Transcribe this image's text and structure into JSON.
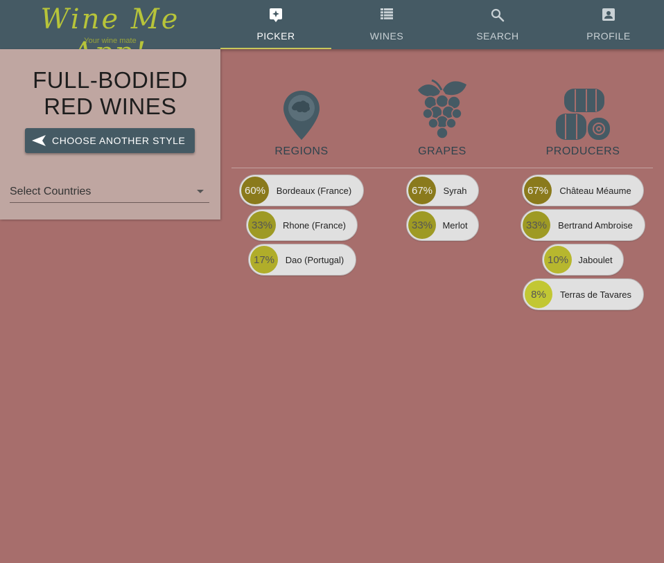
{
  "app": {
    "title": "Wine Me App!",
    "tagline": "Your wine mate"
  },
  "nav": {
    "tabs": [
      {
        "label": "PICKER",
        "icon": "sparkle-icon",
        "active": true
      },
      {
        "label": "WINES",
        "icon": "list-icon",
        "active": false
      },
      {
        "label": "SEARCH",
        "icon": "search-icon",
        "active": false
      },
      {
        "label": "PROFILE",
        "icon": "profile-icon",
        "active": false
      }
    ]
  },
  "side": {
    "title_line1": "FULL-BODIED",
    "title_line2": "RED WINES",
    "choose_label": "CHOOSE ANOTHER STYLE",
    "select_label": "Select Countries"
  },
  "columns": {
    "regions": {
      "header": "REGIONS",
      "items": [
        {
          "pct": "60%",
          "name": "Bordeaux (France)"
        },
        {
          "pct": "33%",
          "name": "Rhone (France)"
        },
        {
          "pct": "17%",
          "name": "Dao (Portugal)"
        }
      ]
    },
    "grapes": {
      "header": "GRAPES",
      "items": [
        {
          "pct": "67%",
          "name": "Syrah"
        },
        {
          "pct": "33%",
          "name": "Merlot"
        }
      ]
    },
    "producers": {
      "header": "PRODUCERS",
      "items": [
        {
          "pct": "67%",
          "name": "Château Méaume"
        },
        {
          "pct": "33%",
          "name": "Bertrand Ambroise"
        },
        {
          "pct": "10%",
          "name": "Jaboulet"
        },
        {
          "pct": "8%",
          "name": "Terras de Tavares"
        }
      ]
    }
  },
  "colors": {
    "topbar": "#455a64",
    "accent": "#b7c43a",
    "background": "#a76e6c",
    "badge_60": "#8a7a1c",
    "badge_33": "#9e9a24",
    "badge_17": "#b0ad2a",
    "badge_8": "#c2c733"
  }
}
